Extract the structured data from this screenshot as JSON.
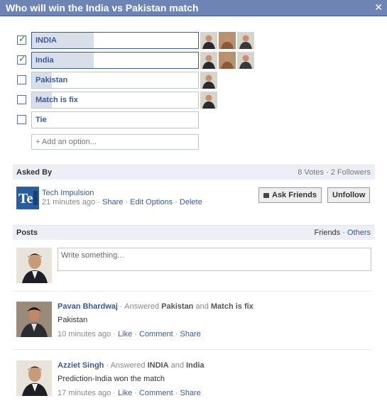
{
  "dialog": {
    "title": "Who will win the India vs Pakistan match",
    "close_glyph": "✕"
  },
  "options": [
    {
      "label": "INDIA",
      "checked": true,
      "fill_fraction": 0.37,
      "voter_icons": [
        "voter-avatar-icon",
        "voter-avatar-icon",
        "voter-avatar-icon"
      ]
    },
    {
      "label": "India",
      "checked": true,
      "fill_fraction": 0.37,
      "voter_icons": [
        "voter-avatar-icon",
        "voter-avatar-icon",
        "voter-avatar-icon"
      ]
    },
    {
      "label": "Pakistan",
      "checked": false,
      "fill_fraction": 0.12,
      "voter_icons": [
        "voter-avatar-icon"
      ]
    },
    {
      "label": "Match is fix",
      "checked": false,
      "fill_fraction": 0.12,
      "voter_icons": [
        "voter-avatar-icon"
      ]
    },
    {
      "label": "Tie",
      "checked": false,
      "fill_fraction": 0,
      "voter_icons": []
    }
  ],
  "add_option": {
    "placeholder": "+ Add an option..."
  },
  "asked_by": {
    "heading": "Asked By",
    "votes": "8 Votes",
    "sep": "·",
    "followers": "2 Followers",
    "name": "Tech Impulsion",
    "time": "21 minutes ago",
    "share": "Share",
    "edit_options": "Edit Options",
    "delete": "Delete",
    "ask_friends": "Ask Friends",
    "unfollow": "Unfollow"
  },
  "posts_section": {
    "heading": "Posts",
    "friends": "Friends",
    "sep": "·",
    "others": "Others",
    "composer_placeholder": "Write something..."
  },
  "posts": [
    {
      "name": "Pavan Bhardwaj",
      "answered": "Answered",
      "a1": "Pakistan",
      "and": "and",
      "a2": "Match is fix",
      "body": "Pakistan",
      "time": "10 minutes ago",
      "like": "Like",
      "comment": "Comment",
      "share": "Share"
    },
    {
      "name": "Azziet Singh",
      "answered": "Answered",
      "a1": "INDIA",
      "and": "and",
      "a2": "India",
      "body": "Prediction-India won the match",
      "time": "17 minutes ago",
      "like": "Like",
      "comment": "Comment",
      "share": "Share"
    }
  ],
  "colors": {
    "accent": "#3b5998",
    "titlebar": "#6d84b4",
    "bar_fill": "#d8dfea",
    "section_bg": "#eceff5"
  }
}
